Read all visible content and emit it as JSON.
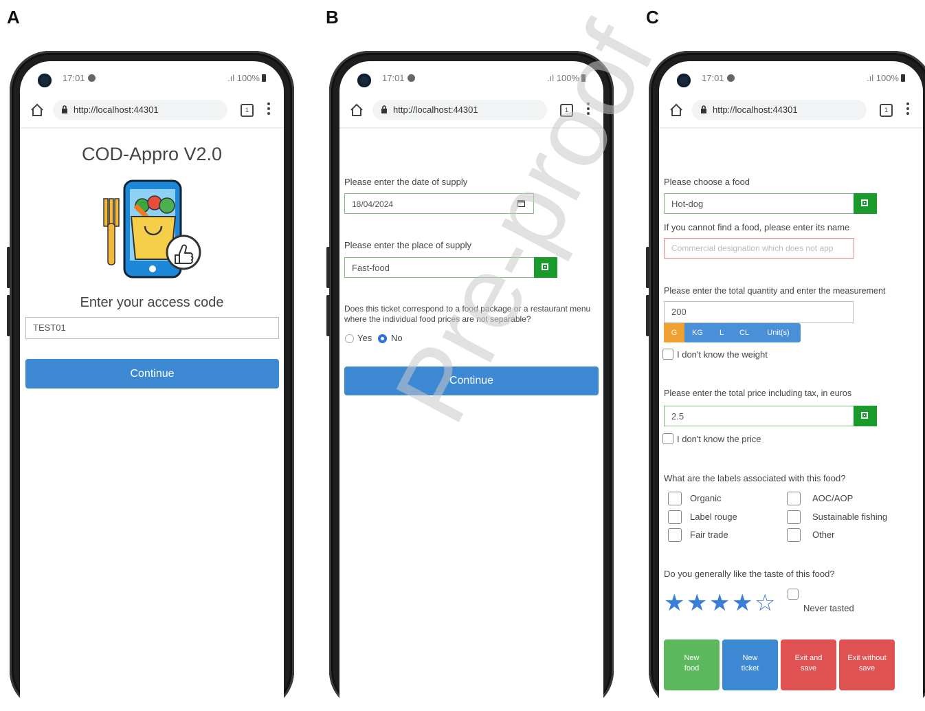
{
  "panels": [
    "A",
    "B",
    "C"
  ],
  "status": {
    "time": "17:01",
    "signal": ".ıl 100%"
  },
  "browser": {
    "url": "http://localhost:44301",
    "tabs_count": "1"
  },
  "screen_a": {
    "title": "COD-Appro V2.0",
    "prompt": "Enter your access code",
    "access_code": "TEST01",
    "continue_label": "Continue"
  },
  "screen_b": {
    "date_label": "Please enter the date of supply",
    "date_value": "18/04/2024",
    "place_label": "Please enter the place of supply",
    "place_value": "Fast-food",
    "question": "Does this ticket correspond to a food package or a restaurant menu where the individual food prices are not separable?",
    "yes_label": "Yes",
    "no_label": "No",
    "selected": "No",
    "continue_label": "Continue"
  },
  "screen_c": {
    "food_label": "Please choose a food",
    "food_value": "Hot-dog",
    "food_hint": "If you cannot find a food, please enter its name",
    "food_placeholder": "Commercial designation which does not app",
    "qty_label": "Please enter the total quantity and enter the measurement",
    "qty_value": "200",
    "units": [
      "G",
      "KG",
      "L",
      "CL",
      "Unit(s)"
    ],
    "selected_unit": "G",
    "dont_know_weight": "I don't know the weight",
    "price_label": "Please enter the total price including tax, in euros",
    "price_value": "2.5",
    "dont_know_price": "I don't know the price",
    "labels_question": "What are the labels associated with this food?",
    "labels_left": [
      "Organic",
      "Label rouge",
      "Fair trade"
    ],
    "labels_right": [
      "AOC/AOP",
      "Sustainable fishing",
      "Other"
    ],
    "taste_question": "Do you generally like the taste of this food?",
    "rating": 4,
    "rating_max": 5,
    "never_tasted": "Never tasted",
    "actions": [
      {
        "line1": "New",
        "line2": "food",
        "color": "#5cb85c"
      },
      {
        "line1": "New",
        "line2": "ticket",
        "color": "#3d88d3"
      },
      {
        "line1": "Exit and",
        "line2": "save",
        "color": "#e05252"
      },
      {
        "line1": "Exit without",
        "line2": "save",
        "color": "#e05252"
      }
    ]
  },
  "watermark": "Pre-proof"
}
